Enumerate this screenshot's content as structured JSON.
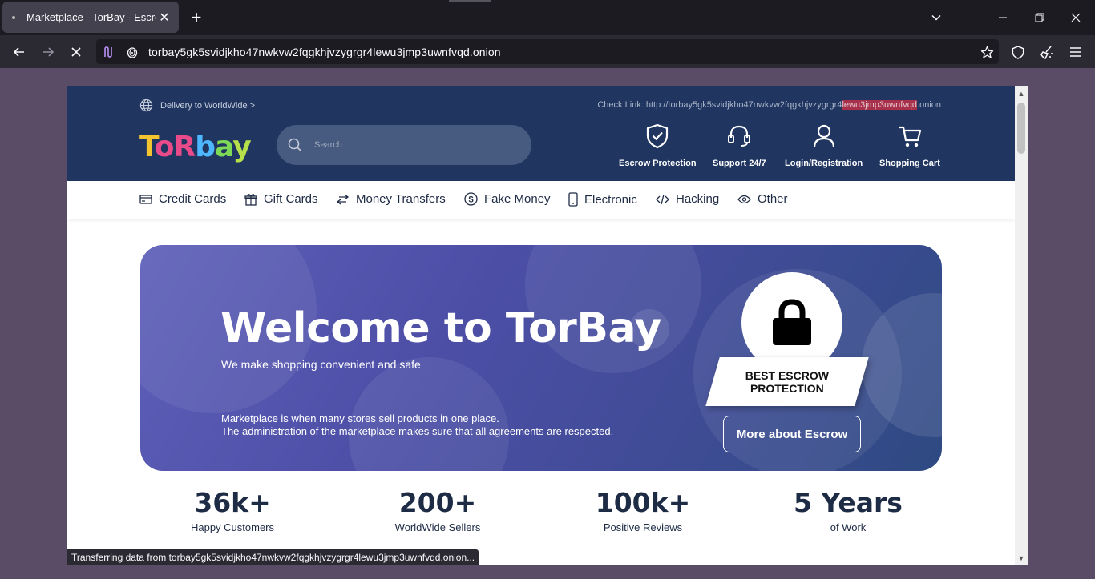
{
  "browser": {
    "tab_title": "Marketplace - TorBay - Escrow",
    "url": "torbay5gk5svidjkho47nwkvw2fqgkhjvzygrgr4lewu3jmp3uwnfvqd.onion",
    "status": "Transferring data from torbay5gk5svidjkho47nwkvw2fqgkhjvzygrgr4lewu3jmp3uwnfvqd.onion..."
  },
  "header": {
    "delivery": "Delivery to WorldWide >",
    "checklink_prefix": "Check Link: http://torbay5gk5svidjkho47nwkvw2fqgkhjvzygrgr4",
    "checklink_highlight": "lewu3jmp3uwnfvqd",
    "checklink_suffix": ".onion",
    "logo_letters": [
      "T",
      "o",
      "R",
      "b",
      "a",
      "y"
    ],
    "logo_colors": [
      "#f4c430",
      "#e94b8a",
      "#e94b8a",
      "#4db8ff",
      "#7ed957",
      "#b7e04a"
    ],
    "search_placeholder": "Search",
    "actions": {
      "escrow": "Escrow Protection",
      "support": "Support 24/7",
      "login": "Login/Registration",
      "cart": "Shopping Cart"
    }
  },
  "categories": {
    "credit_cards": "Credit Cards",
    "gift_cards": "Gift Cards",
    "money_transfers": "Money Transfers",
    "fake_money": "Fake Money",
    "electronic": "Electronic",
    "hacking": "Hacking",
    "other": "Other"
  },
  "hero": {
    "title": "Welcome to TorBay",
    "subtitle": "We make shopping convenient and safe",
    "desc_line1": "Marketplace is when many stores sell products in one place.",
    "desc_line2": "The administration of the marketplace makes sure that all agreements are respected.",
    "badge": "BEST ESCROW PROTECTION",
    "button": "More about Escrow"
  },
  "stats": {
    "customers_num": "36k+",
    "customers_label": "Happy Customers",
    "sellers_num": "200+",
    "sellers_label": "WorldWide Sellers",
    "reviews_num": "100k+",
    "reviews_label": "Positive Reviews",
    "years_num": "5 Years",
    "years_label": "of Work"
  }
}
